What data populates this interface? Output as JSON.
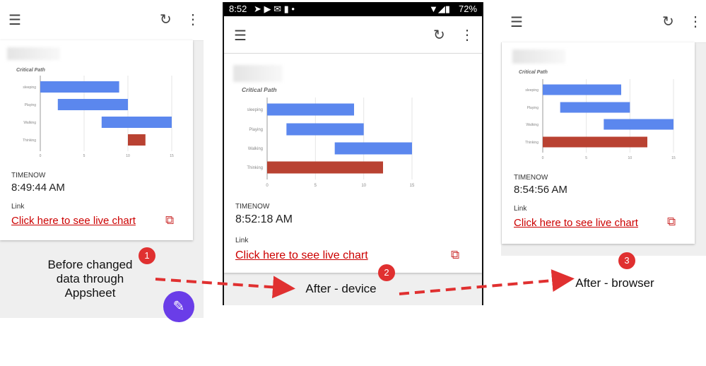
{
  "panels": [
    {
      "caption": "Before changed data through Appsheet",
      "badge": "1",
      "timenow_label": "TIMENOW",
      "timenow_value": "8:49:44 AM",
      "link_label": "Link",
      "link_text": "Click here to see live chart",
      "icons": [
        "menu-icon",
        "refresh-icon",
        "more-vert-icon",
        "open-external-icon",
        "edit-fab-icon"
      ]
    },
    {
      "caption": "After - device",
      "badge": "2",
      "status_bar": {
        "time": "8:52",
        "battery": "72%"
      },
      "timenow_label": "TIMENOW",
      "timenow_value": "8:52:18 AM",
      "link_label": "Link",
      "link_text": "Click here to see live chart",
      "icons": [
        "menu-icon",
        "refresh-icon",
        "more-vert-icon",
        "open-external-icon"
      ]
    },
    {
      "caption": "After - browser",
      "badge": "3",
      "timenow_label": "TIMENOW",
      "timenow_value": "8:54:56 AM",
      "link_label": "Link",
      "link_text": "Click here to see live chart",
      "icons": [
        "menu-icon",
        "refresh-icon",
        "more-vert-icon",
        "open-external-icon"
      ]
    }
  ],
  "colors": {
    "bar": "#5b87ee",
    "critical": "#b94232",
    "link": "#cc0000",
    "fab": "#6a3de8",
    "annotation": "#e03030"
  },
  "chart_data": [
    {
      "type": "bar",
      "subtype": "gantt",
      "title": "Critical Path",
      "categories": [
        "sleeping",
        "Playing",
        "Walking",
        "Thinking"
      ],
      "start": [
        0,
        2,
        7,
        10
      ],
      "end": [
        9,
        10,
        15,
        12
      ],
      "critical": [
        false,
        false,
        false,
        true
      ],
      "xticks": [
        0,
        5,
        10,
        15
      ],
      "xlim": [
        0,
        15
      ],
      "grid": true
    },
    {
      "type": "bar",
      "subtype": "gantt",
      "title": "Critical Path",
      "categories": [
        "sleeping",
        "Playing",
        "Walking",
        "Thinking"
      ],
      "start": [
        0,
        2,
        7,
        0
      ],
      "end": [
        9,
        10,
        15,
        12
      ],
      "critical": [
        false,
        false,
        false,
        true
      ],
      "xticks": [
        0,
        5,
        10,
        15
      ],
      "xlim": [
        0,
        15
      ],
      "grid": true
    },
    {
      "type": "bar",
      "subtype": "gantt",
      "title": "Critical Path",
      "categories": [
        "sleeping",
        "Playing",
        "Walking",
        "Thinking"
      ],
      "start": [
        0,
        2,
        7,
        0
      ],
      "end": [
        9,
        10,
        15,
        12
      ],
      "critical": [
        false,
        false,
        false,
        true
      ],
      "xticks": [
        0,
        5,
        10,
        15
      ],
      "xlim": [
        0,
        15
      ],
      "grid": true
    }
  ]
}
